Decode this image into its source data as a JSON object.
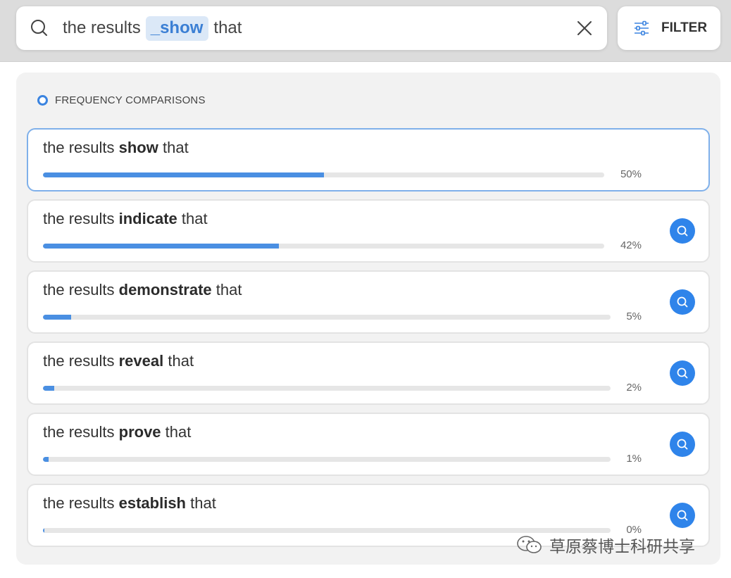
{
  "search": {
    "prefix": "the results",
    "chip": "_show",
    "suffix": "that"
  },
  "filter": {
    "label": "FILTER"
  },
  "section": {
    "title": "FREQUENCY COMPARISONS"
  },
  "results": [
    {
      "before": "the results",
      "word": "show",
      "after": "that",
      "percent_label": "50%",
      "fraction": 0.5,
      "selected": true
    },
    {
      "before": "the results",
      "word": "indicate",
      "after": "that",
      "percent_label": "42%",
      "fraction": 0.42,
      "selected": false
    },
    {
      "before": "the results",
      "word": "demonstrate",
      "after": "that",
      "percent_label": "5%",
      "fraction": 0.05,
      "selected": false
    },
    {
      "before": "the results",
      "word": "reveal",
      "after": "that",
      "percent_label": "2%",
      "fraction": 0.02,
      "selected": false
    },
    {
      "before": "the results",
      "word": "prove",
      "after": "that",
      "percent_label": "1%",
      "fraction": 0.01,
      "selected": false
    },
    {
      "before": "the results",
      "word": "establish",
      "after": "that",
      "percent_label": "0%",
      "fraction": 0.003,
      "selected": false
    }
  ],
  "watermark": {
    "text": "草原蔡博士科研共享"
  },
  "colors": {
    "accent": "#3b84e0",
    "bar": "#4a8fe2",
    "lookup": "#2f84ea"
  },
  "icons": {
    "search": "search-icon",
    "clear": "close-icon",
    "filter": "sliders-icon",
    "lookup": "search-icon"
  }
}
